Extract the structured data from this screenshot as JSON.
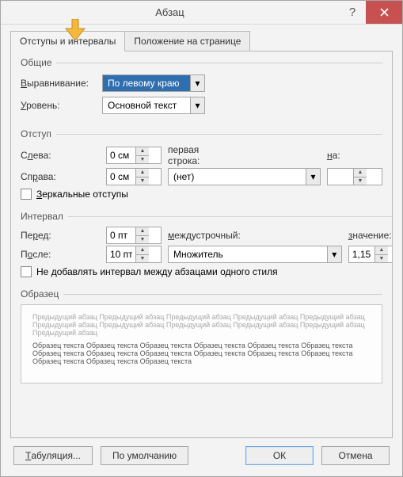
{
  "window": {
    "title": "Абзац"
  },
  "tabs": {
    "active": "Отступы и интервалы",
    "inactive": "Положение на странице"
  },
  "general": {
    "legend": "Общие",
    "alignment_label": "Выравнивание:",
    "alignment_value": "По левому краю",
    "level_label": "Уровень:",
    "level_value": "Основной текст"
  },
  "indent": {
    "legend": "Отступ",
    "left_label": "Слева:",
    "left_value": "0 см",
    "right_label": "Справа:",
    "right_value": "0 см",
    "first_line_label": "первая строка:",
    "first_line_value": "(нет)",
    "by_label": "на:",
    "by_value": "",
    "mirror_label": "Зеркальные отступы"
  },
  "spacing": {
    "legend": "Интервал",
    "before_label": "Перед:",
    "before_value": "0 пт",
    "after_label": "После:",
    "after_value": "10 пт",
    "line_label": "междустрочный:",
    "line_value": "Множитель",
    "at_label": "значение:",
    "at_value": "1,15",
    "nospace_label": "Не добавлять интервал между абзацами одного стиля"
  },
  "preview": {
    "legend": "Образец",
    "prev": "Предыдущий абзац Предыдущий абзац Предыдущий абзац Предыдущий абзац Предыдущий абзац Предыдущий абзац Предыдущий абзац Предыдущий абзац Предыдущий абзац Предыдущий абзац Предыдущий абзац",
    "sample": "Образец текста Образец текста Образец текста Образец текста Образец текста Образец текста Образец текста Образец текста Образец текста Образец текста Образец текста Образец текста Образец текста Образец текста Образец текста"
  },
  "footer": {
    "tabs": "Табуляция...",
    "default": "По умолчанию",
    "ok": "ОК",
    "cancel": "Отмена"
  },
  "first_letters": {
    "alignment": "В",
    "level": "У",
    "left": "л",
    "right": "р",
    "mirror": "З",
    "before": "р",
    "after": "о",
    "nospace": "д",
    "tabs": "Т",
    "interline": "м",
    "by": "н",
    "at": "з"
  }
}
